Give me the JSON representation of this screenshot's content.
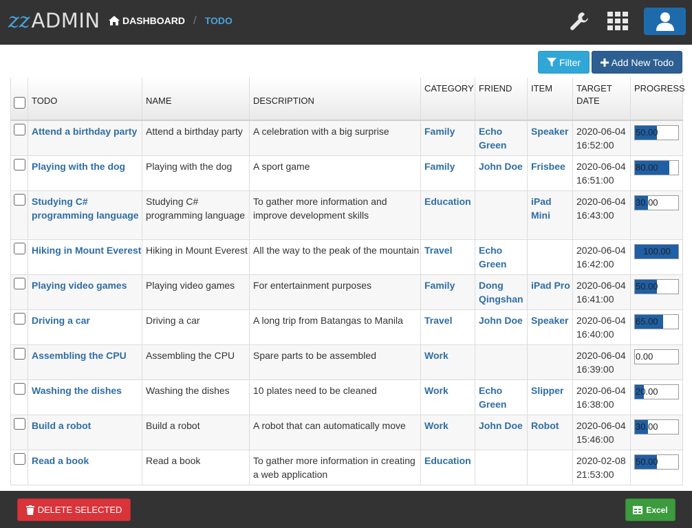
{
  "app": {
    "logo_mark": "zz",
    "logo_text": "ADMIN",
    "breadcrumb_home": "DASHBOARD",
    "breadcrumb_current": "TODO"
  },
  "toolbar": {
    "filter_label": "Filter",
    "add_label": "Add New Todo"
  },
  "table": {
    "headers": {
      "todo": "TODO",
      "name": "NAME",
      "description": "DESCRIPTION",
      "category": "CATEGORY",
      "friend": "FRIEND",
      "item": "ITEM",
      "target_date_1": "TARGET",
      "target_date_2": "DATE",
      "progress": "PROGRESS"
    },
    "rows": [
      {
        "todo": "Attend a birthday party",
        "name": "Attend a birthday party",
        "description": "A celebration with a big surprise",
        "category": "Family",
        "friend": "Echo Green",
        "item": "Speaker",
        "date": "2020-06-04",
        "time": "16:52:00",
        "progress": "50.00",
        "progress_value": 0.5
      },
      {
        "todo": "Playing with the dog",
        "name": "Playing with the dog",
        "description": "A sport game",
        "category": "Family",
        "friend": "John Doe",
        "item": "Frisbee",
        "date": "2020-06-04",
        "time": "16:51:00",
        "progress": "80.00",
        "progress_value": 0.8
      },
      {
        "todo": "Studying C# programming language",
        "name": "Studying C# programming language",
        "description": "To gather more information and improve development skills",
        "category": "Education",
        "friend": "",
        "item": "iPad Mini",
        "date": "2020-06-04",
        "time": "16:43:00",
        "progress": "30.00",
        "progress_value": 0.3
      },
      {
        "todo": "Hiking in Mount Everest",
        "name": "Hiking in Mount Everest",
        "description": "All the way to the peak of the mountain",
        "category": "Travel",
        "friend": "Echo Green",
        "item": "",
        "date": "2020-06-04",
        "time": "16:42:00",
        "progress": "100.00",
        "progress_value": 1.0
      },
      {
        "todo": "Playing video games",
        "name": "Playing video games",
        "description": "For entertainment purposes",
        "category": "Family",
        "friend": "Dong Qingshan",
        "item": "iPad Pro",
        "date": "2020-06-04",
        "time": "16:41:00",
        "progress": "50.00",
        "progress_value": 0.5
      },
      {
        "todo": "Driving a car",
        "name": "Driving a car",
        "description": "A long trip from Batangas to Manila",
        "category": "Travel",
        "friend": "John Doe",
        "item": "Speaker",
        "date": "2020-06-04",
        "time": "16:40:00",
        "progress": "65.00",
        "progress_value": 0.65
      },
      {
        "todo": "Assembling the CPU",
        "name": "Assembling the CPU",
        "description": "Spare parts to be assembled",
        "category": "Work",
        "friend": "",
        "item": "",
        "date": "2020-06-04",
        "time": "16:39:00",
        "progress": "0.00",
        "progress_value": 0.0
      },
      {
        "todo": "Washing the dishes",
        "name": "Washing the dishes",
        "description": "10 plates need to be cleaned",
        "category": "Work",
        "friend": "Echo Green",
        "item": "Slipper",
        "date": "2020-06-04",
        "time": "16:38:00",
        "progress": "20.00",
        "progress_value": 0.2
      },
      {
        "todo": "Build a robot",
        "name": "Build a robot",
        "description": "A robot that can automatically move",
        "category": "Work",
        "friend": "John Doe",
        "item": "Robot",
        "date": "2020-06-04",
        "time": "15:46:00",
        "progress": "30.00",
        "progress_value": 0.3
      },
      {
        "todo": "Read a book",
        "name": "Read a book",
        "description": "To gather more information in creating a web application",
        "category": "Education",
        "friend": "",
        "item": "",
        "date": "2020-02-08",
        "time": "21:53:00",
        "progress": "50.00",
        "progress_value": 0.5
      }
    ]
  },
  "footer": {
    "delete_label": "DELETE SELECTED",
    "excel_label": "Excel"
  },
  "colors": {
    "topbar": "#333333",
    "accent": "#4aa3df",
    "link": "#2e6da4",
    "progress_fill": "#1f5fa5",
    "danger": "#d9343a",
    "success": "#3c9b3c"
  },
  "icons": {
    "home": "home-icon",
    "wrench": "wrench-icon",
    "grid": "apps-grid-icon",
    "user": "user-icon",
    "filter": "filter-icon",
    "plus": "plus-icon",
    "trash": "trash-icon",
    "excel": "table-icon"
  }
}
